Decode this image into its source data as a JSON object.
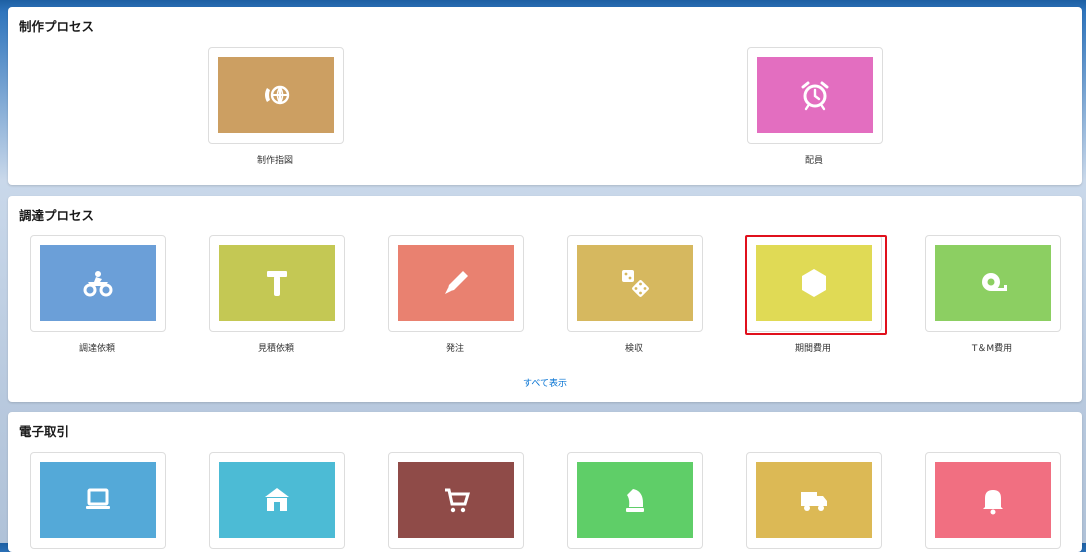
{
  "sections": {
    "production": {
      "title": "制作プロセス",
      "tiles": [
        {
          "label": "制作指図",
          "color": "#cc9f62",
          "icon": "globe-call-icon"
        },
        {
          "label": "配員",
          "color": "#e36ec0",
          "icon": "alarm-clock-icon"
        }
      ]
    },
    "procurement": {
      "title": "調達プロセス",
      "tiles": [
        {
          "label": "調達依頼",
          "color": "#6b9fd8",
          "icon": "quad-bike-icon"
        },
        {
          "label": "見積依頼",
          "color": "#c4c854",
          "icon": "hammer-icon"
        },
        {
          "label": "発注",
          "color": "#e98170",
          "icon": "pencil-icon"
        },
        {
          "label": "検収",
          "color": "#d6b85f",
          "icon": "dice-icon"
        },
        {
          "label": "期間費用",
          "color": "#e0da55",
          "icon": "hexagon-icon"
        },
        {
          "label": "T＆M費用",
          "color": "#8ccf62",
          "icon": "tape-measure-icon"
        }
      ],
      "view_all": "すべて表示"
    },
    "ecommerce": {
      "title": "電子取引",
      "tiles": [
        {
          "color": "#54a9d8",
          "icon": "laptop-icon"
        },
        {
          "color": "#4cbbd5",
          "icon": "store-icon"
        },
        {
          "color": "#8f4b48",
          "icon": "cart-icon"
        },
        {
          "color": "#5fce68",
          "icon": "chess-knight-icon"
        },
        {
          "color": "#dcb955",
          "icon": "truck-icon"
        },
        {
          "color": "#f16f81",
          "icon": "bell-icon"
        }
      ]
    }
  },
  "highlight_color": "#e0101c"
}
